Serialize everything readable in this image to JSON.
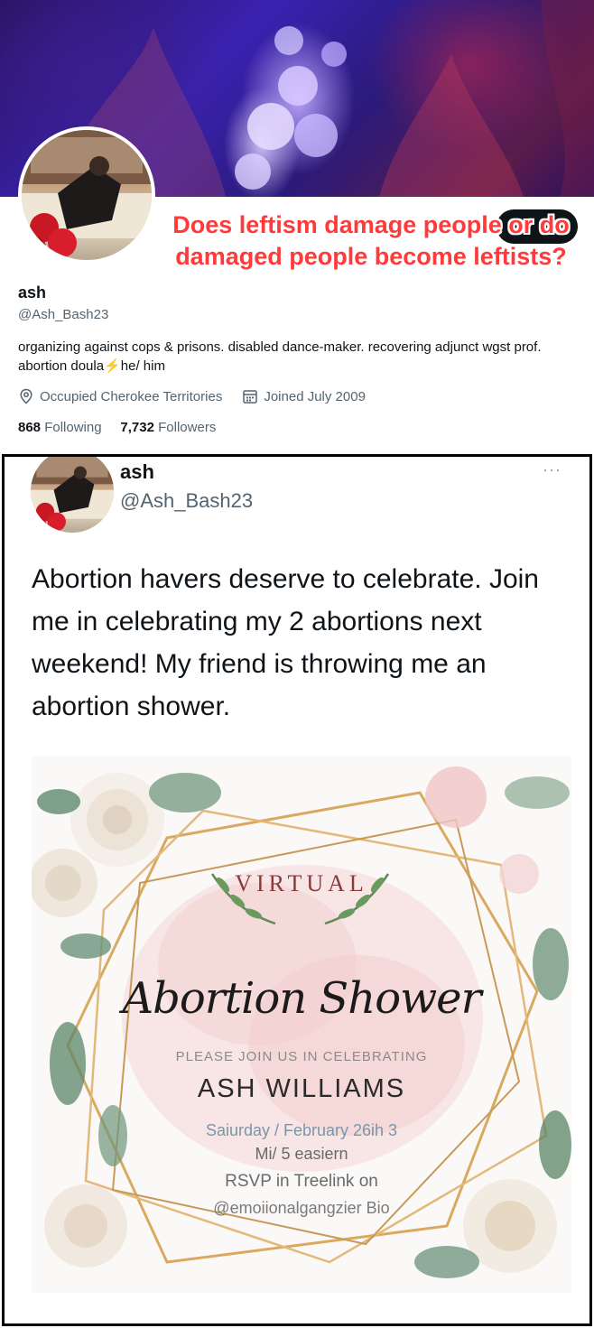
{
  "caption": {
    "text": "Does leftism damage people or do damaged people become leftists?"
  },
  "profile": {
    "name": "ash",
    "handle": "@Ash_Bash23",
    "bio": "organizing against cops & prisons. disabled dance-maker. recovering adjunct wgst prof. abortion doula",
    "bio_emoji": "⚡",
    "bio_tail": "he/ him",
    "location": "Occupied Cherokee Territories",
    "joined": "Joined July 2009",
    "following_count": "868",
    "following_label": "Following",
    "followers_count": "7,732",
    "followers_label": "Followers"
  },
  "tweet": {
    "name": "ash",
    "handle": "@Ash_Bash23",
    "more_icon": "···",
    "text": "Abortion havers deserve to celebrate. Join me in celebrating my 2 abortions next weekend! My friend is throwing me an abortion shower."
  },
  "invitation": {
    "virtual": "VIRTUAL",
    "title": "Abortion Shower",
    "please": "PLEASE JOIN US IN CELEBRATING",
    "honoree": "ASH WILLIAMS",
    "date": "Saiurday / February 26ih 3",
    "time": "Mi/ 5 easiern",
    "rsvp": "RSVP in Treelink on",
    "bio": "@emoiionalgangzier Bio"
  },
  "colors": {
    "caption": "#ff3a3a",
    "muted": "#536471",
    "text": "#0f1419"
  }
}
